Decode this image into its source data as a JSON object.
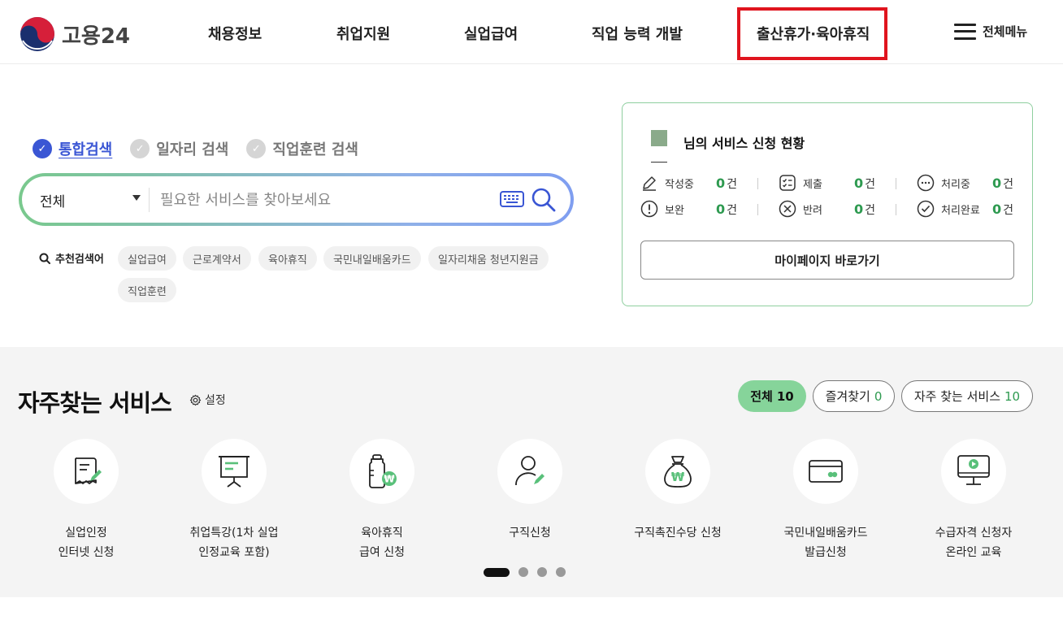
{
  "header": {
    "logo_text": "고용24",
    "nav": [
      "채용정보",
      "취업지원",
      "실업급여",
      "직업 능력 개발",
      "출산휴가·육아휴직"
    ],
    "all_menu_label": "전체메뉴"
  },
  "search": {
    "tabs": [
      "통합검색",
      "일자리 검색",
      "직업훈련 검색"
    ],
    "scope_value": "전체",
    "placeholder": "필요한 서비스를 찾아보세요",
    "recommend_label": "추천검색어",
    "keywords": [
      "실업급여",
      "근로계약서",
      "육아휴직",
      "국민내일배움카드",
      "일자리채움 청년지원금",
      "직업훈련"
    ]
  },
  "status": {
    "title": "님의 서비스 신청 현황",
    "unit": "건",
    "items": [
      {
        "label": "작성중",
        "count": "0",
        "icon": "pencil-icon"
      },
      {
        "label": "제출",
        "count": "0",
        "icon": "checklist-icon"
      },
      {
        "label": "처리중",
        "count": "0",
        "icon": "ellipsis-icon"
      },
      {
        "label": "보완",
        "count": "0",
        "icon": "exclamation-icon"
      },
      {
        "label": "반려",
        "count": "0",
        "icon": "x-circle-icon"
      },
      {
        "label": "처리완료",
        "count": "0",
        "icon": "check-circle-icon"
      }
    ],
    "mypage_label": "마이페이지 바로가기"
  },
  "frequent": {
    "title": "자주찾는 서비스",
    "setting_label": "설정",
    "filters": [
      {
        "label": "전체",
        "count": "10"
      },
      {
        "label": "즐겨찾기",
        "count": "0"
      },
      {
        "label": "자주 찾는 서비스",
        "count": "10"
      }
    ],
    "services": [
      {
        "label": "실업인정\n인터넷 신청",
        "icon": "document-pen-icon"
      },
      {
        "label": "취업특강(1차 실업\n인정교육 포함)",
        "icon": "presentation-board-icon"
      },
      {
        "label": "육아휴직\n급여 신청",
        "icon": "baby-bottle-won-icon"
      },
      {
        "label": "구직신청",
        "icon": "person-pen-icon"
      },
      {
        "label": "구직촉진수당 신청",
        "icon": "money-bag-won-icon"
      },
      {
        "label": "국민내일배움카드\n발급신청",
        "icon": "card-icon"
      },
      {
        "label": "수급자격 신청자\n온라인 교육",
        "icon": "monitor-play-icon"
      }
    ]
  },
  "colors": {
    "accent_green": "#2e9a50",
    "pill_green": "#86d49a",
    "active_tab_blue": "#3a56d4",
    "highlight_red": "#e0141e"
  }
}
